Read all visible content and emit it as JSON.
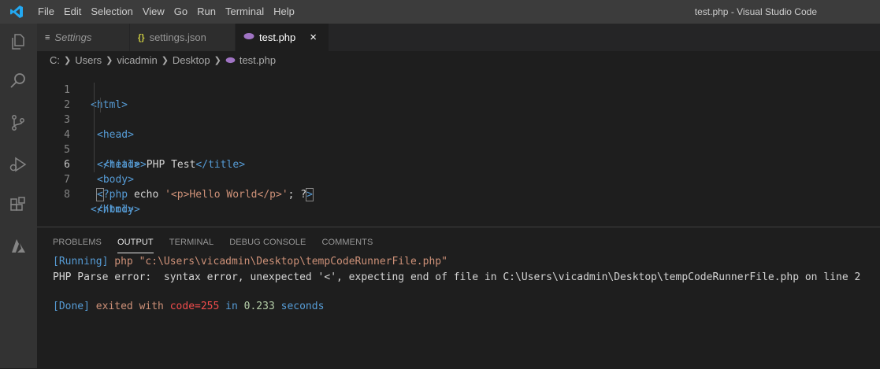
{
  "app": {
    "menu": [
      "File",
      "Edit",
      "Selection",
      "View",
      "Go",
      "Run",
      "Terminal",
      "Help"
    ],
    "window_title": "test.php - Visual Studio Code"
  },
  "activity_bar": {
    "icons": [
      "explorer-icon",
      "search-icon",
      "source-control-icon",
      "run-debug-icon",
      "extensions-icon",
      "azure-icon"
    ]
  },
  "tabs": [
    {
      "label": "Settings",
      "icon": "settings-icon",
      "active": false
    },
    {
      "label": "settings.json",
      "icon": "json-icon",
      "active": false
    },
    {
      "label": "test.php",
      "icon": "php-icon",
      "active": true
    }
  ],
  "tab_close": "×",
  "breadcrumb": [
    "C:",
    "Users",
    "vicadmin",
    "Desktop",
    "test.php"
  ],
  "editor": {
    "line_numbers": [
      "1",
      "2",
      "3",
      "4",
      "5",
      "6",
      "7",
      "8"
    ],
    "lines": {
      "l1": {
        "t1": "<html>"
      },
      "l2": {
        "t1": "<head>"
      },
      "l3": {
        "t1": "<title>",
        "text": "PHP Test",
        "t2": "</title>"
      },
      "l4": {
        "t1": "</head>"
      },
      "l5": {
        "t1": "<body>"
      },
      "l6": {
        "a": "<",
        "b": "?php ",
        "c": "echo ",
        "d": "'<p>Hello World</p>'",
        "e": "; ?",
        ">": ">"
      },
      "l7": {
        "t1": "</body>"
      },
      "l8": {
        "t1": "</html>"
      }
    }
  },
  "panel": {
    "tabs": [
      "PROBLEMS",
      "OUTPUT",
      "TERMINAL",
      "DEBUG CONSOLE",
      "COMMENTS"
    ],
    "active_tab": "OUTPUT",
    "output": {
      "running_tag": "[Running]",
      "running_cmd": " php \"c:\\Users\\vicadmin\\Desktop\\tempCodeRunnerFile.php\"",
      "error_line": "PHP Parse error:  syntax error, unexpected '<', expecting end of file in C:\\Users\\vicadmin\\Desktop\\tempCodeRunnerFile.php on line 2",
      "done_tag": "[Done]",
      "done_exited": " exited with ",
      "done_code": "code=255",
      "done_in": " in ",
      "done_time": "0.233",
      "done_seconds": " seconds"
    }
  }
}
